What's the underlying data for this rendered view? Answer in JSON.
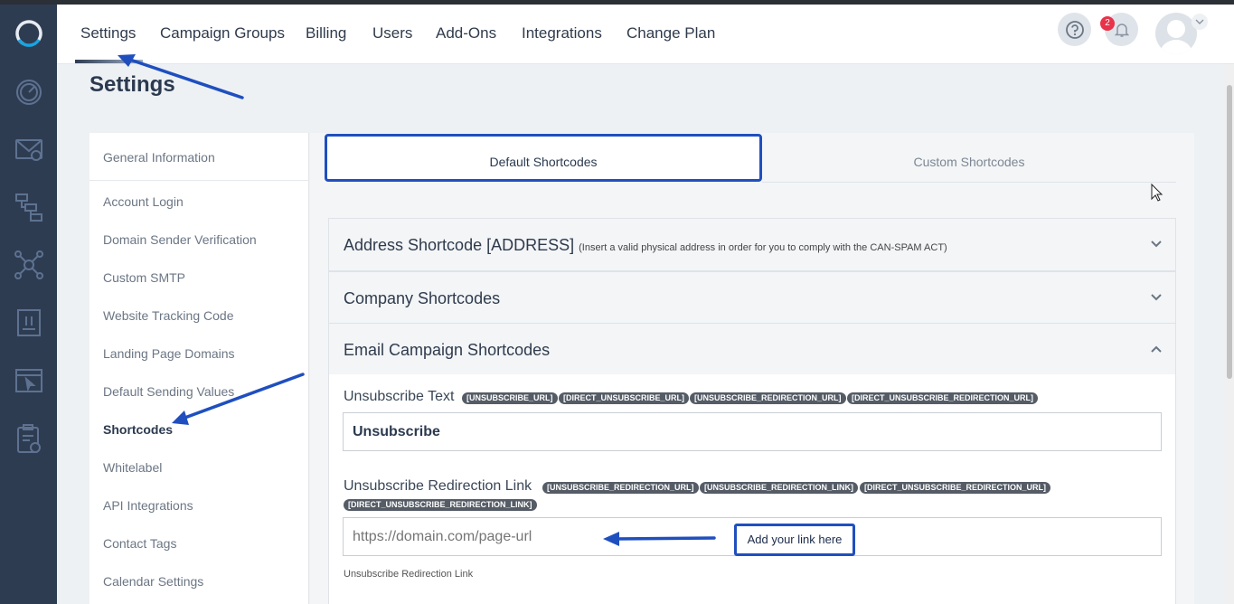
{
  "nav": {
    "tabs": [
      "Settings",
      "Campaign Groups",
      "Billing",
      "Users",
      "Add-Ons",
      "Integrations",
      "Change Plan"
    ],
    "notifications_count": "2"
  },
  "page": {
    "title": "Settings"
  },
  "side_menu": {
    "items": [
      "General Information",
      "Account Login",
      "Domain Sender Verification",
      "Custom SMTP",
      "Website Tracking Code",
      "Landing Page Domains",
      "Default Sending Values",
      "Shortcodes",
      "Whitelabel",
      "API Integrations",
      "Contact Tags",
      "Calendar Settings"
    ],
    "active": "Shortcodes"
  },
  "subtabs": {
    "default": "Default Shortcodes",
    "custom": "Custom Shortcodes"
  },
  "accordions": {
    "address": {
      "title": "Address Shortcode [ADDRESS]",
      "note": "(Insert a valid physical address in order for you to comply with the CAN-SPAM ACT)"
    },
    "company": {
      "title": "Company Shortcodes"
    },
    "email": {
      "title": "Email Campaign Shortcodes"
    }
  },
  "unsubscribe_text": {
    "label": "Unsubscribe Text",
    "chips": [
      "[UNSUBSCRIBE_URL]",
      "[DIRECT_UNSUBSCRIBE_URL]",
      "[UNSUBSCRIBE_REDIRECTION_URL]",
      "[DIRECT_UNSUBSCRIBE_REDIRECTION_URL]"
    ],
    "value": "Unsubscribe"
  },
  "unsubscribe_redirect": {
    "label": "Unsubscribe Redirection Link",
    "chips": [
      "[UNSUBSCRIBE_REDIRECTION_URL]",
      "[UNSUBSCRIBE_REDIRECTION_LINK]",
      "[DIRECT_UNSUBSCRIBE_REDIRECTION_URL]",
      "[DIRECT_UNSUBSCRIBE_REDIRECTION_LINK]"
    ],
    "placeholder": "https://domain.com/page-url",
    "hint": "Unsubscribe Redirection Link"
  },
  "annotation": {
    "callout": "Add your link here"
  },
  "colors": {
    "rail": "#2e3c52",
    "annotation_blue": "#1f4fbf",
    "badge": "#e8334a"
  }
}
